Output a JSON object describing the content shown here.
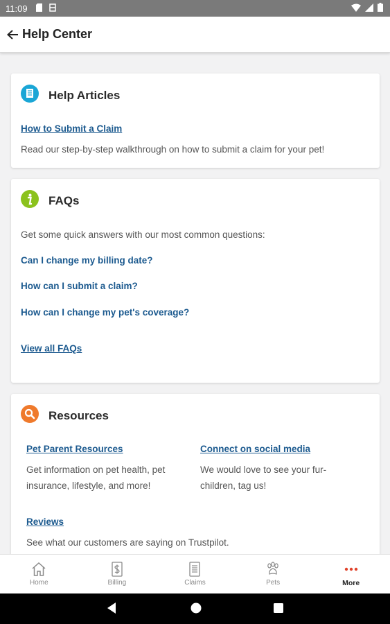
{
  "status_bar": {
    "time": "11:09"
  },
  "header": {
    "title": "Help Center"
  },
  "help_articles": {
    "title": "Help Articles",
    "link": "How to Submit a Claim",
    "description": "Read our step-by-step walkthrough on how to submit a claim for your pet!"
  },
  "faqs": {
    "title": "FAQs",
    "intro": "Get some quick answers with our most common questions:",
    "questions": [
      "Can I change my billing date?",
      "How can I submit a claim?",
      "How can I change my pet's coverage?"
    ],
    "view_all": "View all FAQs"
  },
  "resources": {
    "title": "Resources",
    "items": [
      {
        "link": "Pet Parent Resources",
        "description_line1": "Get information on pet health, pet",
        "description_line2": "insurance, lifestyle, and more!"
      },
      {
        "link": "Connect on social media",
        "description_line1": "We would love to see your fur-",
        "description_line2": "children, tag us!"
      },
      {
        "link": "Reviews",
        "description_line1": "See what our customers are saying on Trustpilot.",
        "description_line2": ""
      }
    ]
  },
  "bottom_nav": {
    "items": [
      {
        "label": "Home",
        "icon": "home-icon"
      },
      {
        "label": "Billing",
        "icon": "dollar-icon"
      },
      {
        "label": "Claims",
        "icon": "document-icon"
      },
      {
        "label": "Pets",
        "icon": "paw-icon"
      },
      {
        "label": "More",
        "icon": "more-dots-icon"
      }
    ],
    "active_index": 4
  },
  "colors": {
    "accent_link": "#1c5a8f",
    "help_articles_icon": "#1aa6d6",
    "faq_icon": "#8bc21d",
    "resources_icon": "#ef7a2c",
    "more_active": "#e0422a"
  }
}
